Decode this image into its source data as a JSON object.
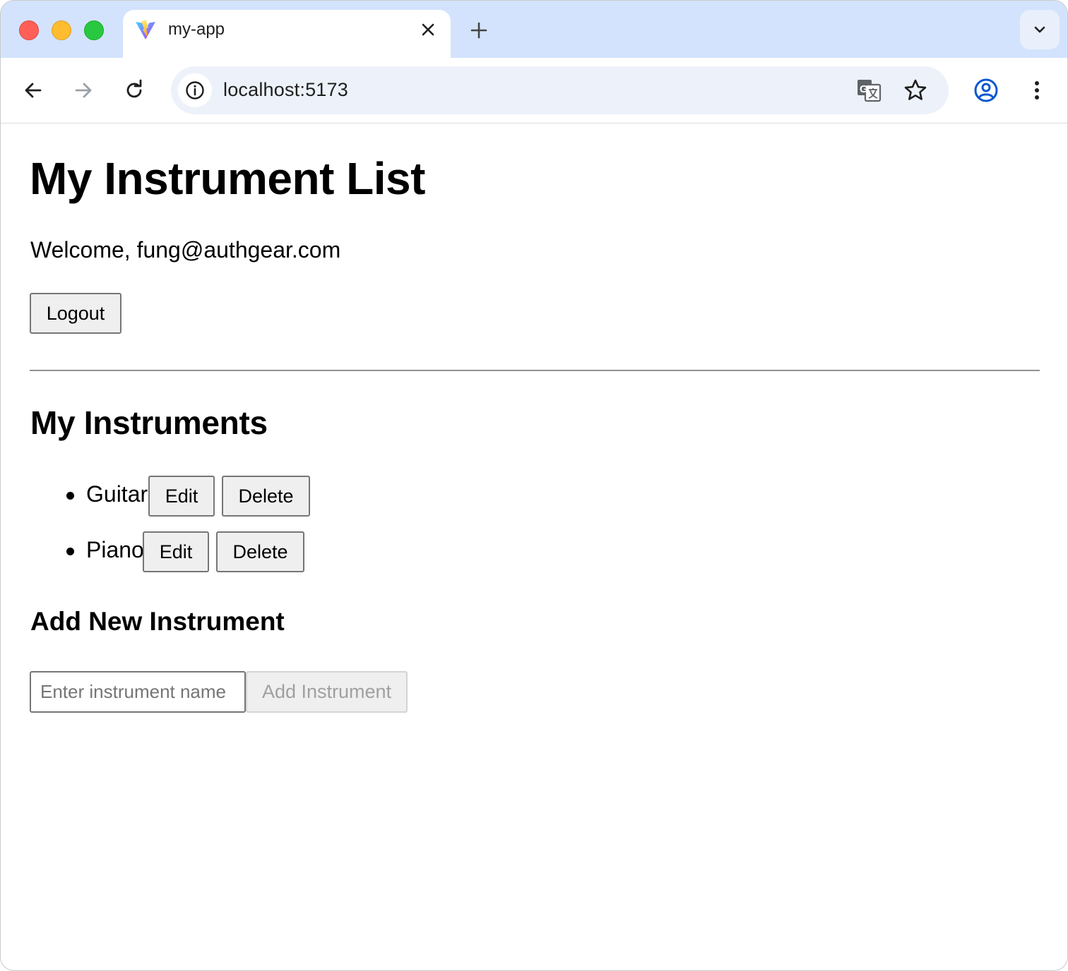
{
  "browser": {
    "tab_title": "my-app",
    "url": "localhost:5173"
  },
  "page": {
    "title": "My Instrument List",
    "welcome": "Welcome, fung@authgear.com",
    "logout_label": "Logout",
    "section_title": "My Instruments",
    "instruments": [
      {
        "name": "Guitar",
        "edit_label": "Edit",
        "delete_label": "Delete"
      },
      {
        "name": "Piano",
        "edit_label": "Edit",
        "delete_label": "Delete"
      }
    ],
    "add_title": "Add New Instrument",
    "input_placeholder": "Enter instrument name",
    "input_value": "",
    "add_button_label": "Add Instrument"
  },
  "icons": {
    "favicon": "vite-logo-icon",
    "tab_close": "close-icon",
    "new_tab": "plus-icon",
    "tab_search": "chevron-down-icon",
    "back": "arrow-left-icon",
    "forward": "arrow-right-icon",
    "reload": "reload-icon",
    "site_info": "info-icon",
    "translate": "translate-icon",
    "bookmark": "star-icon",
    "profile": "profile-icon",
    "menu": "kebab-menu-icon"
  },
  "colors": {
    "tabstrip_bg": "#d3e3fd",
    "omnibox_bg": "#edf2fa",
    "profile_blue": "#0b57d0",
    "button_bg": "#efefef"
  }
}
